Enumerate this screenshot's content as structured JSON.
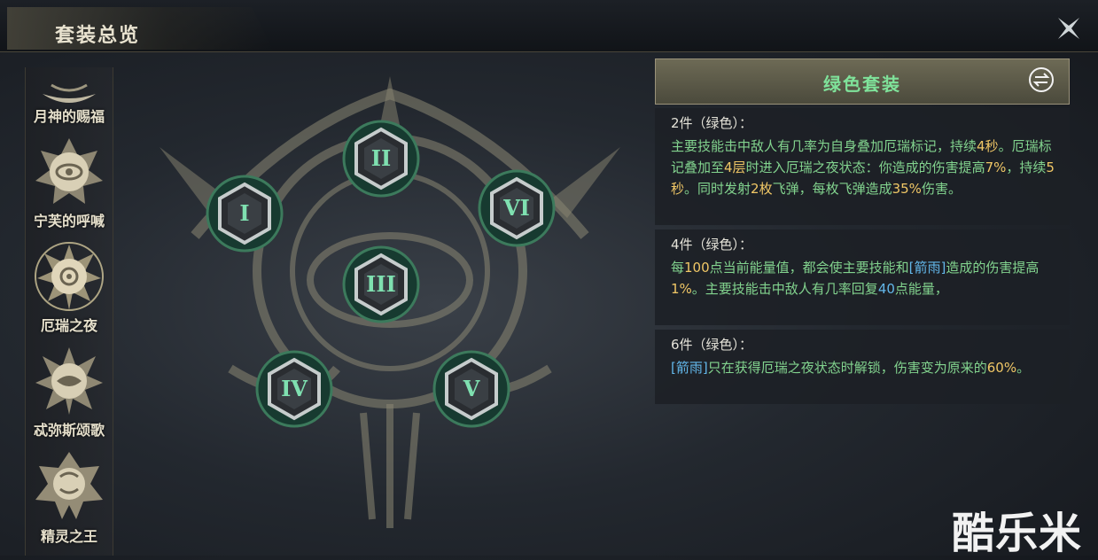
{
  "header": {
    "title": "套装总览"
  },
  "sidebar": {
    "items": [
      {
        "label": "月神的赐福"
      },
      {
        "label": "宁芙的呼喊"
      },
      {
        "label": "厄瑞之夜"
      },
      {
        "label": "忒弥斯颂歌"
      },
      {
        "label": "精灵之王"
      }
    ]
  },
  "nodes": [
    "I",
    "II",
    "III",
    "IV",
    "V",
    "VI"
  ],
  "panel": {
    "title": "绿色套装",
    "tiers": [
      {
        "head": "2件（绿色）：",
        "t1": "主要技能击中敌人有几率为自身叠加厄瑞标记，持续",
        "v1": "4秒",
        "t2": "。厄瑞标记叠加至",
        "v2": "4层",
        "t3": "时进入厄瑞之夜状态：你造成的伤害提高",
        "v3": "7%",
        "t4": "，持续",
        "v4": "5秒",
        "t5": "。同时发射",
        "v5": "2枚",
        "t6": "飞弹，每枚飞弹造成",
        "v6": "35%",
        "t7": "伤害。"
      },
      {
        "head": "4件（绿色）：",
        "t1": "每",
        "v1": "100",
        "t2": "点当前能量值，都会使主要技能和",
        "k1": "[箭雨]",
        "t3": "造成的伤害提高",
        "v2": "1%",
        "t4": "。主要技能击中敌人有几率回复",
        "k2": "40",
        "t5": "点能量，"
      },
      {
        "head": "6件（绿色）：",
        "k1": "[箭雨]",
        "t1": "只在获得厄瑞之夜状态时解锁，伤害变为原来的",
        "v1": "60%",
        "t2": "。"
      }
    ]
  },
  "watermark": "酷乐米",
  "colors": {
    "set_green": "#82d38e",
    "value_gold": "#f0c766",
    "keyword_blue": "#63b7ea"
  }
}
